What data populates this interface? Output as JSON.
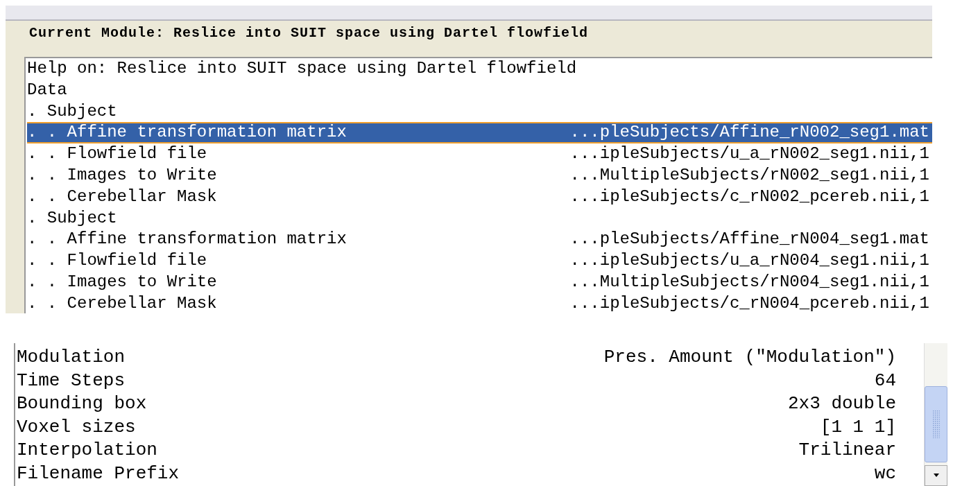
{
  "header": "Current Module: Reslice into SUIT space using Dartel flowfield",
  "help": "Help on: Reslice into SUIT space using Dartel flowfield",
  "tree": [
    {
      "label": "Data",
      "selected": false,
      "children": [
        {
          "label": ". Subject",
          "selected": false,
          "children": [
            {
              "label": ". . Affine transformation matrix",
              "value": "...pleSubjects/Affine_rN002_seg1.mat",
              "selected": true
            },
            {
              "label": ". . Flowfield file",
              "value": "...ipleSubjects/u_a_rN002_seg1.nii,1",
              "selected": false
            },
            {
              "label": ". . Images to Write",
              "value": "...MultipleSubjects/rN002_seg1.nii,1",
              "selected": false
            },
            {
              "label": ". . Cerebellar Mask",
              "value": "...ipleSubjects/c_rN002_pcereb.nii,1",
              "selected": false
            }
          ]
        },
        {
          "label": ". Subject",
          "selected": false,
          "children": [
            {
              "label": ". . Affine transformation matrix",
              "value": "...pleSubjects/Affine_rN004_seg1.mat",
              "selected": false
            },
            {
              "label": ". . Flowfield file",
              "value": "...ipleSubjects/u_a_rN004_seg1.nii,1",
              "selected": false
            },
            {
              "label": ". . Images to Write",
              "value": "...MultipleSubjects/rN004_seg1.nii,1",
              "selected": false
            },
            {
              "label": ". . Cerebellar Mask",
              "value": "...ipleSubjects/c_rN004_pcereb.nii,1",
              "selected": false
            }
          ]
        }
      ]
    }
  ],
  "options": [
    {
      "label": "Modulation",
      "value": "Pres. Amount (\"Modulation\")"
    },
    {
      "label": "Time Steps",
      "value": "64"
    },
    {
      "label": "Bounding box",
      "value": "2x3 double"
    },
    {
      "label": "Voxel sizes",
      "value": "[1 1 1]"
    },
    {
      "label": "Interpolation",
      "value": "Trilinear"
    },
    {
      "label": "Filename Prefix",
      "value": "wc"
    }
  ]
}
